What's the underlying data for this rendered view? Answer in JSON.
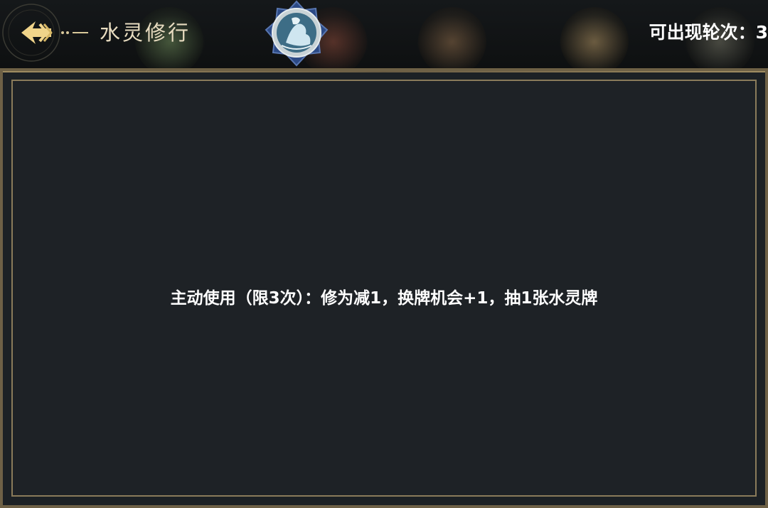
{
  "header": {
    "title": "水灵修行",
    "round_count_label": "可出现轮次：3"
  },
  "icons": {
    "back": "back-arrow-icon",
    "emblem": "water-spirit-emblem-icon"
  },
  "card": {
    "effect_text": "主动使用（限3次）：修为减1，换牌机会+1，抽1张水灵牌"
  },
  "colors": {
    "title_gold": "#e8dcc0",
    "frame_gold": "#8a7b5a",
    "panel_bg": "#1e2226",
    "emblem_blue": "#2c4a86"
  }
}
